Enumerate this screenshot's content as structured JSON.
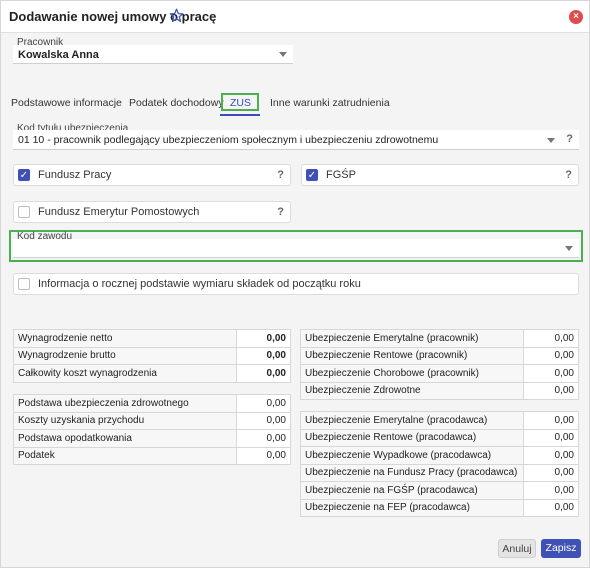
{
  "dialog": {
    "title": "Dodawanie nowej umowy o pracę",
    "close_symbol": "×"
  },
  "employee": {
    "label": "Pracownik",
    "value": "Kowalska Anna"
  },
  "tabs": [
    {
      "label": "Podstawowe informacje",
      "active": false
    },
    {
      "label": "Podatek dochodowy",
      "active": false
    },
    {
      "label": "ZUS",
      "active": true
    },
    {
      "label": "Inne warunki zatrudnienia",
      "active": false
    }
  ],
  "zus": {
    "code_label": "Kod tytułu ubezpieczenia",
    "code_value": "01 10 - pracownik podlegający ubezpieczeniom społecznym i ubezpieczeniu zdrowotnemu",
    "help": "?",
    "checks": {
      "fundusz_pracy": {
        "label": "Fundusz Pracy",
        "checked": true
      },
      "fgsp": {
        "label": "FGŚP",
        "checked": true
      },
      "femp": {
        "label": "Fundusz Emerytur Pomostowych",
        "checked": false
      },
      "roczna": {
        "label": "Informacja o rocznej podstawie wymiaru składek od początku roku",
        "checked": false
      }
    },
    "kod_zawodu_label": "Kod zawodu",
    "kod_zawodu_value": ""
  },
  "left_table_top": [
    {
      "name": "Wynagrodzenie netto",
      "value": "0,00"
    },
    {
      "name": "Wynagrodzenie brutto",
      "value": "0,00"
    },
    {
      "name": "Całkowity koszt wynagrodzenia",
      "value": "0,00"
    }
  ],
  "left_table_bottom": [
    {
      "name": "Podstawa ubezpieczenia zdrowotnego",
      "value": "0,00"
    },
    {
      "name": "Koszty uzyskania przychodu",
      "value": "0,00"
    },
    {
      "name": "Podstawa opodatkowania",
      "value": "0,00"
    },
    {
      "name": "Podatek",
      "value": "0,00"
    }
  ],
  "right_table_top": [
    {
      "name": "Ubezpieczenie Emerytalne (pracownik)",
      "value": "0,00"
    },
    {
      "name": "Ubezpieczenie Rentowe (pracownik)",
      "value": "0,00"
    },
    {
      "name": "Ubezpieczenie Chorobowe (pracownik)",
      "value": "0,00"
    },
    {
      "name": "Ubezpieczenie Zdrowotne",
      "value": "0,00"
    }
  ],
  "right_table_bottom": [
    {
      "name": "Ubezpieczenie Emerytalne (pracodawca)",
      "value": "0,00"
    },
    {
      "name": "Ubezpieczenie Rentowe (pracodawca)",
      "value": "0,00"
    },
    {
      "name": "Ubezpieczenie Wypadkowe (pracodawca)",
      "value": "0,00"
    },
    {
      "name": "Ubezpieczenie na Fundusz Pracy (pracodawca)",
      "value": "0,00"
    },
    {
      "name": "Ubezpieczenie na FGŚP (pracodawca)",
      "value": "0,00"
    },
    {
      "name": "Ubezpieczenie na FEP (pracodawca)",
      "value": "0,00"
    }
  ],
  "footer": {
    "cancel_label": "Anuluj",
    "save_label": "Zapisz"
  },
  "colors": {
    "accent": "#3f51b5",
    "highlight": "#4caf50",
    "close": "#e24b4b"
  }
}
